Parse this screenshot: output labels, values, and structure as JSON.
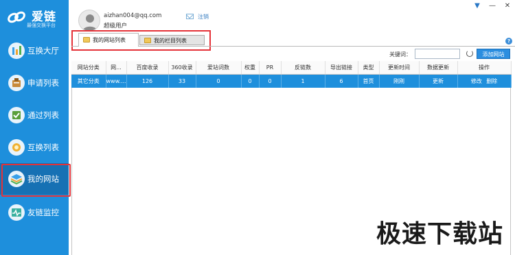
{
  "app": {
    "name": "爱链",
    "subtitle": "最强交换平台"
  },
  "user": {
    "email": "aizhan004@qq.com",
    "role": "超级用户",
    "logout_label": "注销"
  },
  "sidebar": {
    "items": [
      {
        "label": "互换大厅",
        "icon": "hall-icon",
        "active": false
      },
      {
        "label": "申请列表",
        "icon": "apply-list-icon",
        "active": false
      },
      {
        "label": "通过列表",
        "icon": "approved-list-icon",
        "active": false
      },
      {
        "label": "互换列表",
        "icon": "exchange-list-icon",
        "active": false
      },
      {
        "label": "我的网站",
        "icon": "my-site-icon",
        "active": true
      },
      {
        "label": "友链监控",
        "icon": "monitor-icon",
        "active": false
      }
    ]
  },
  "tabs": [
    {
      "label": "我的网站列表",
      "active": true
    },
    {
      "label": "我的栏目列表",
      "active": false
    }
  ],
  "search": {
    "label": "关键词：",
    "value": "",
    "add_button": "添加网站"
  },
  "table": {
    "headers": [
      "网站分类",
      "网...",
      "百度收录",
      "360收录",
      "爱站词数",
      "权重",
      "PR",
      "反链数",
      "导出链接",
      "类型",
      "更新时间",
      "数据更新",
      "操作"
    ],
    "rows": [
      {
        "category": "其它分类",
        "site": "www....",
        "baidu": "126",
        "so360": "33",
        "aizhan": "0",
        "weight": "0",
        "pr": "0",
        "backlinks": "1",
        "outlinks": "6",
        "type": "首页",
        "updated": "刚刚",
        "data_update": "更新",
        "edit": "修改",
        "delete": "删除"
      }
    ]
  },
  "watermark": "极速下载站",
  "colors": {
    "sidebar": "#1e8fdc",
    "sidebar_active": "#1671b4",
    "highlight_border": "#e53238",
    "selected_row": "#1e8fdc",
    "button": "#2b8ee0"
  }
}
